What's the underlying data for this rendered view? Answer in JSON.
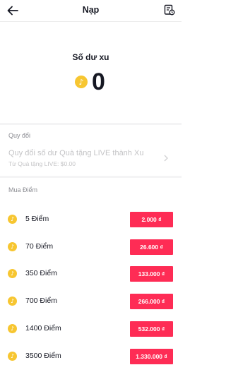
{
  "header": {
    "title": "Nạp"
  },
  "balance": {
    "label": "Số dư xu",
    "value": "0"
  },
  "exchange": {
    "section_label": "Quy đổi",
    "title": "Quy đổi số dư Quà tặng LIVE thành Xu",
    "subtitle": "Từ Quà tặng LIVE: $0.00"
  },
  "buy": {
    "section_label": "Mua Điểm",
    "items": [
      {
        "label": "5 Điểm",
        "price": "2.000 ₫"
      },
      {
        "label": "70 Điểm",
        "price": "26.600 ₫"
      },
      {
        "label": "350 Điểm",
        "price": "133.000 ₫"
      },
      {
        "label": "700 Điểm",
        "price": "266.000 ₫"
      },
      {
        "label": "1400 Điểm",
        "price": "532.000 ₫"
      },
      {
        "label": "3500 Điểm",
        "price": "1.330.000 ₫"
      }
    ]
  },
  "colors": {
    "accent": "#fe2c55",
    "coin": "#f7c631",
    "muted": "#8a8b91"
  }
}
